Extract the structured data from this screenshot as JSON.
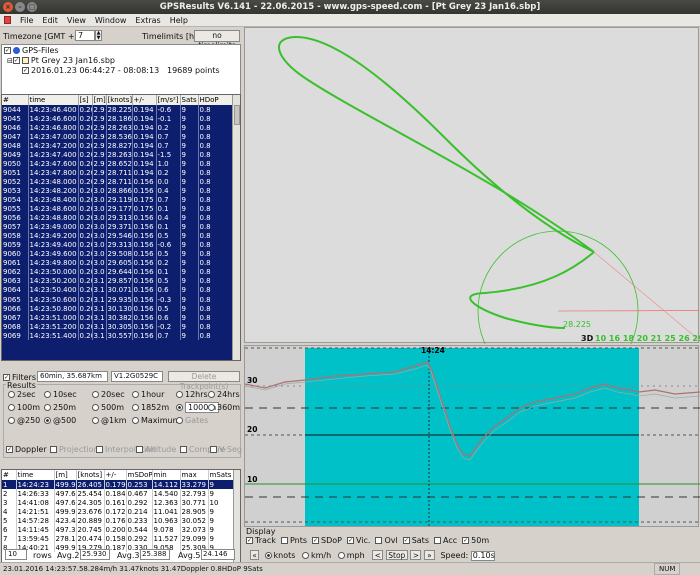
{
  "window": {
    "title": "GPSResults V6.141 - 22.06.2015 - www.gps-speed.com - [Pt Grey 23 Jan16.sbp]"
  },
  "menu": [
    "File",
    "Edit",
    "View",
    "Window",
    "Extras",
    "Help"
  ],
  "timezone": {
    "label": "Timezone [GMT +/- h]:",
    "value": "7"
  },
  "timelimits": {
    "label": "Timelimits [hhmm]",
    "button": "no timelimits"
  },
  "tree": {
    "root": "GPS-Files",
    "file": "Pt Grey 23 Jan16.sbp",
    "session": "2016.01.23 06:44:27 - 08:08:13",
    "points": "19689 points"
  },
  "points_table": {
    "headers": [
      "#",
      "time",
      "[s]",
      "[m]",
      "[knots]",
      "+/-",
      "[m/s²]",
      "Sats",
      "HDoP"
    ],
    "rows": [
      [
        "9044",
        "14:23:46.400",
        "0.200",
        "2.9",
        "28.225",
        "0.194",
        "-0.6",
        "9",
        "0.8"
      ],
      [
        "9045",
        "14:23:46.600",
        "0.200",
        "2.9",
        "28.186",
        "0.194",
        "-0.1",
        "9",
        "0.8"
      ],
      [
        "9046",
        "14:23:46.800",
        "0.200",
        "2.9",
        "28.263",
        "0.194",
        "0.2",
        "9",
        "0.8"
      ],
      [
        "9047",
        "14:23:47.000",
        "0.200",
        "2.9",
        "28.536",
        "0.194",
        "0.7",
        "9",
        "0.8"
      ],
      [
        "9048",
        "14:23:47.200",
        "0.200",
        "2.9",
        "28.827",
        "0.194",
        "0.7",
        "9",
        "0.8"
      ],
      [
        "9049",
        "14:23:47.400",
        "0.200",
        "2.9",
        "28.263",
        "0.194",
        "-1.5",
        "9",
        "0.8"
      ],
      [
        "9050",
        "14:23:47.600",
        "0.200",
        "2.9",
        "28.652",
        "0.194",
        "1.0",
        "9",
        "0.8"
      ],
      [
        "9051",
        "14:23:47.800",
        "0.200",
        "2.9",
        "28.711",
        "0.194",
        "0.2",
        "9",
        "0.8"
      ],
      [
        "9052",
        "14:23:48.000",
        "0.200",
        "2.9",
        "28.711",
        "0.156",
        "0.0",
        "9",
        "0.8"
      ],
      [
        "9053",
        "14:23:48.200",
        "0.200",
        "3.0",
        "28.866",
        "0.156",
        "0.4",
        "9",
        "0.8"
      ],
      [
        "9054",
        "14:23:48.400",
        "0.200",
        "3.0",
        "29.119",
        "0.175",
        "0.7",
        "9",
        "0.8"
      ],
      [
        "9055",
        "14:23:48.600",
        "0.200",
        "3.0",
        "29.177",
        "0.175",
        "0.1",
        "9",
        "0.8"
      ],
      [
        "9056",
        "14:23:48.800",
        "0.200",
        "3.0",
        "29.313",
        "0.156",
        "0.4",
        "9",
        "0.8"
      ],
      [
        "9057",
        "14:23:49.000",
        "0.200",
        "3.0",
        "29.371",
        "0.156",
        "0.1",
        "9",
        "0.8"
      ],
      [
        "9058",
        "14:23:49.200",
        "0.200",
        "3.0",
        "29.546",
        "0.156",
        "0.5",
        "9",
        "0.8"
      ],
      [
        "9059",
        "14:23:49.400",
        "0.200",
        "3.0",
        "29.313",
        "0.156",
        "-0.6",
        "9",
        "0.8"
      ],
      [
        "9060",
        "14:23:49.600",
        "0.200",
        "3.0",
        "29.508",
        "0.156",
        "0.5",
        "9",
        "0.8"
      ],
      [
        "9061",
        "14:23:49.800",
        "0.200",
        "3.0",
        "29.605",
        "0.156",
        "0.2",
        "9",
        "0.8"
      ],
      [
        "9062",
        "14:23:50.000",
        "0.200",
        "3.0",
        "29.644",
        "0.156",
        "0.1",
        "9",
        "0.8"
      ],
      [
        "9063",
        "14:23:50.200",
        "0.200",
        "3.1",
        "29.857",
        "0.156",
        "0.5",
        "9",
        "0.8"
      ],
      [
        "9064",
        "14:23:50.400",
        "0.200",
        "3.1",
        "30.071",
        "0.156",
        "0.6",
        "9",
        "0.8"
      ],
      [
        "9065",
        "14:23:50.600",
        "0.200",
        "3.1",
        "29.935",
        "0.156",
        "-0.3",
        "9",
        "0.8"
      ],
      [
        "9066",
        "14:23:50.800",
        "0.200",
        "3.1",
        "30.130",
        "0.156",
        "0.5",
        "9",
        "0.8"
      ],
      [
        "9067",
        "14:23:51.000",
        "0.200",
        "3.1",
        "30.382",
        "0.156",
        "0.6",
        "9",
        "0.8"
      ],
      [
        "9068",
        "14:23:51.200",
        "0.200",
        "3.1",
        "30.305",
        "0.156",
        "-0.2",
        "9",
        "0.8"
      ],
      [
        "9069",
        "14:23:51.400",
        "0.200",
        "3.1",
        "30.557",
        "0.156",
        "0.7",
        "9",
        "0.8"
      ]
    ]
  },
  "filters": {
    "label": "Filters",
    "value": "60min, 35.687km",
    "device": "V1.2G0529C",
    "delete": "Delete Trackpoint(s)"
  },
  "results": {
    "label": "Results",
    "options": [
      [
        "2sec",
        "10sec",
        "20sec",
        "1hour",
        "12hrs",
        "24hrs"
      ],
      [
        "100m",
        "250m",
        "500m",
        "1852m",
        "1000m",
        "360m"
      ],
      [
        "@250",
        "@500",
        "@1km",
        "Maximum",
        "Gates"
      ]
    ],
    "checks": [
      "Doppler",
      "Projection",
      "Interpolation",
      "Altitude",
      "Compare",
      "V-Seg"
    ]
  },
  "results_table": {
    "headers": [
      "#",
      "time",
      "[m]",
      "[knots]",
      "+/-",
      "mSDoP",
      "min",
      "max",
      "mSats"
    ],
    "rows": [
      [
        "1",
        "14:24:23",
        "499.9",
        "26.405",
        "0.179",
        "0.253",
        "14.112",
        "33.279",
        "9"
      ],
      [
        "2",
        "14:26:33",
        "497.6",
        "25.454",
        "0.184",
        "0.467",
        "14.540",
        "32.793",
        "9"
      ],
      [
        "3",
        "14:41:08",
        "497.6",
        "24.305",
        "0.161",
        "0.292",
        "12.363",
        "30.771",
        "10"
      ],
      [
        "4",
        "14:21:51",
        "499.9",
        "23.676",
        "0.172",
        "0.214",
        "11.041",
        "28.905",
        "9"
      ],
      [
        "5",
        "14:57:28",
        "423.4",
        "20.889",
        "0.176",
        "0.233",
        "10.963",
        "30.052",
        "9"
      ],
      [
        "6",
        "14:11:45",
        "497.3",
        "20.745",
        "0.200",
        "0.544",
        "9.078",
        "32.073",
        "9"
      ],
      [
        "7",
        "13:59:45",
        "278.1",
        "20.474",
        "0.158",
        "0.292",
        "11.527",
        "29.099",
        "9"
      ],
      [
        "8",
        "14:40:21",
        "499.9",
        "19.279",
        "0.187",
        "0.330",
        "9.058",
        "25.309",
        "9"
      ]
    ]
  },
  "bottom": {
    "rows_value": "10",
    "rows_label": "rows",
    "avg2_label": "Avg.2:",
    "avg2": "25.930",
    "avg3_label": "Avg.3:",
    "avg3": "25.388",
    "avg5_label": "Avg.5:",
    "avg5": "24.146"
  },
  "track": {
    "speed_label": "28.225",
    "sats_prefix": "3D",
    "sats_values": "10 16 18 20 21 25 26 29 31"
  },
  "speedgraph": {
    "cursor_time": "14:24",
    "y_labels": [
      "30",
      "20",
      "10"
    ]
  },
  "display": {
    "label": "Display",
    "items": [
      "Track",
      "Pnts",
      "SDoP",
      "Vic.",
      "Ovl",
      "Sats",
      "Acc",
      "50m"
    ],
    "units": [
      "knots",
      "km/h",
      "mph"
    ],
    "stop": "Stop",
    "speed_label": "Speed:",
    "speed_value": "0.10s"
  },
  "status": {
    "text": "23.01.2016 14:23:57.58.284m/h 31.47knots 31.47Doppler  0.8HDoP  9Sats",
    "num": "NUM"
  }
}
